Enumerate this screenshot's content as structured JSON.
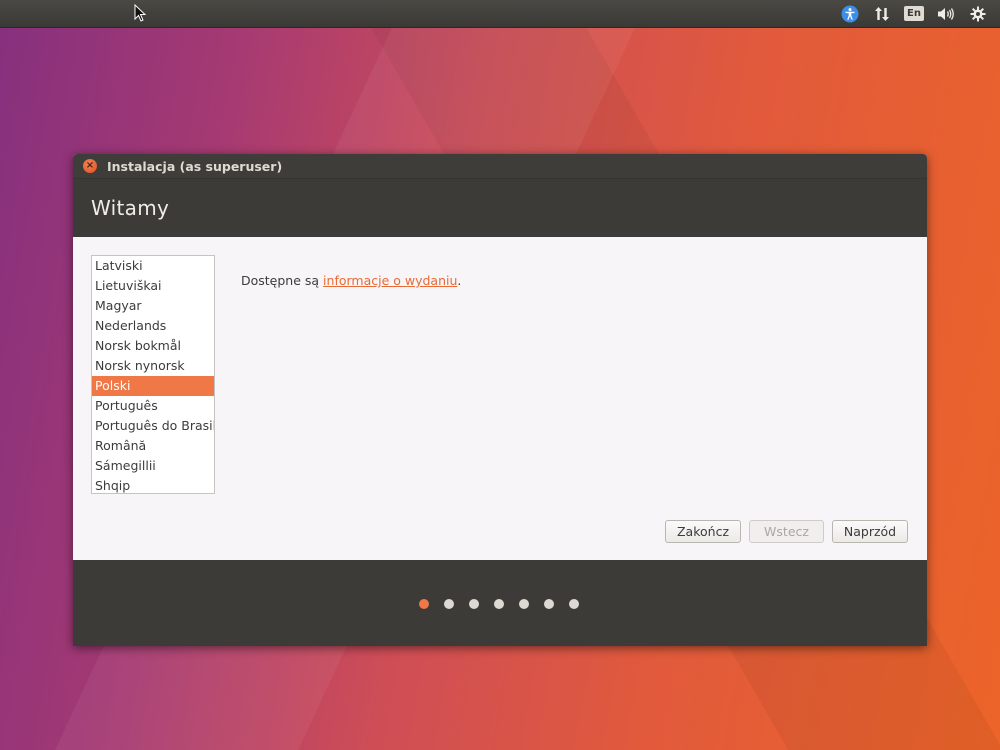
{
  "top_panel": {
    "indicators": [
      "accessibility-icon",
      "network-icon",
      "keyboard-layout",
      "volume-icon",
      "system-menu-icon"
    ],
    "keyboard_layout_label": "En"
  },
  "window": {
    "title": "Instalacja (as superuser)",
    "page_title": "Witamy",
    "languages": [
      "Latviski",
      "Lietuviškai",
      "Magyar",
      "Nederlands",
      "Norsk bokmål",
      "Norsk nynorsk",
      "Polski",
      "Português",
      "Português do Brasil",
      "Română",
      "Sámegillii",
      "Shqip"
    ],
    "selected_language": "Polski",
    "release_note": {
      "prefix": "Dostępne są ",
      "link": "informacje o wydaniu",
      "suffix": "."
    },
    "buttons": {
      "quit": "Zakończ",
      "back": "Wstecz",
      "forward": "Naprzód"
    },
    "progress": {
      "total_steps": 7,
      "current_step": 1
    }
  },
  "colors": {
    "accent": "#f07746",
    "panel": "#3c3b37",
    "link": "#e86b37"
  }
}
